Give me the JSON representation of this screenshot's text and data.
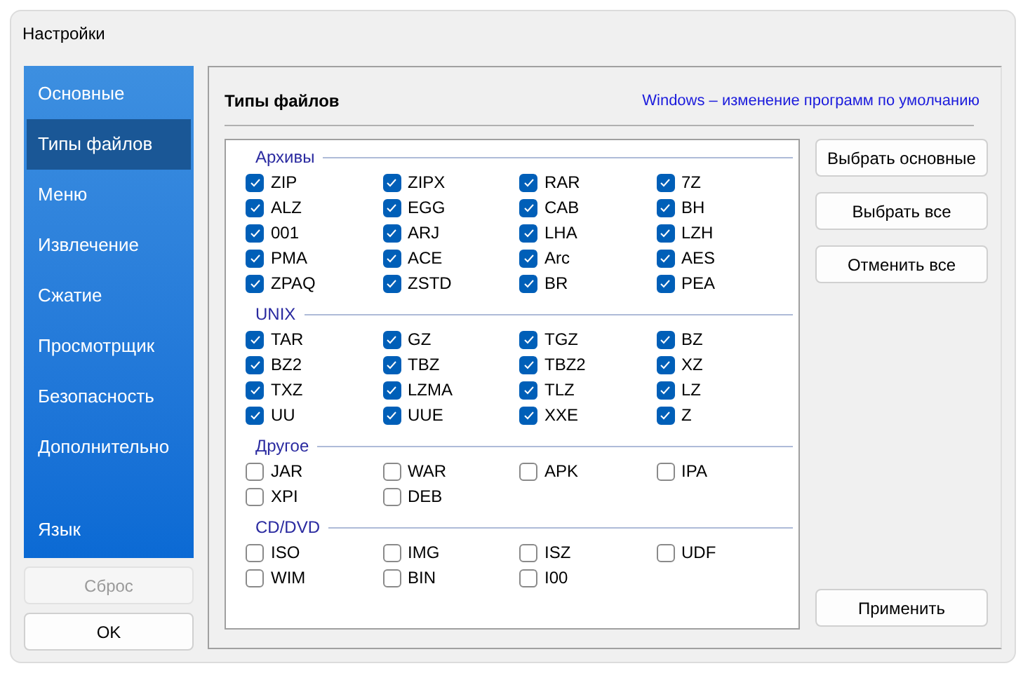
{
  "window": {
    "title": "Настройки"
  },
  "sidebar": {
    "items": [
      {
        "label": "Основные",
        "selected": false
      },
      {
        "label": "Типы файлов",
        "selected": true
      },
      {
        "label": "Меню",
        "selected": false
      },
      {
        "label": "Извлечение",
        "selected": false
      },
      {
        "label": "Сжатие",
        "selected": false
      },
      {
        "label": "Просмотрщик",
        "selected": false
      },
      {
        "label": "Безопасность",
        "selected": false
      },
      {
        "label": "Дополнительно",
        "selected": false
      }
    ],
    "bottom_items": [
      {
        "label": "Язык",
        "selected": false
      }
    ]
  },
  "reset_button": {
    "label": "Сброс",
    "disabled": true
  },
  "ok_button": {
    "label": "OK",
    "disabled": false
  },
  "panel": {
    "title": "Типы файлов",
    "link": "Windows – изменение программ по умолчанию"
  },
  "groups": [
    {
      "title": "Архивы",
      "items": [
        {
          "label": "ZIP",
          "checked": true
        },
        {
          "label": "ZIPX",
          "checked": true
        },
        {
          "label": "RAR",
          "checked": true
        },
        {
          "label": "7Z",
          "checked": true
        },
        {
          "label": "ALZ",
          "checked": true
        },
        {
          "label": "EGG",
          "checked": true
        },
        {
          "label": "CAB",
          "checked": true
        },
        {
          "label": "BH",
          "checked": true
        },
        {
          "label": "001",
          "checked": true
        },
        {
          "label": "ARJ",
          "checked": true
        },
        {
          "label": "LHA",
          "checked": true
        },
        {
          "label": "LZH",
          "checked": true
        },
        {
          "label": "PMA",
          "checked": true
        },
        {
          "label": "ACE",
          "checked": true
        },
        {
          "label": "Arc",
          "checked": true
        },
        {
          "label": "AES",
          "checked": true
        },
        {
          "label": "ZPAQ",
          "checked": true
        },
        {
          "label": "ZSTD",
          "checked": true
        },
        {
          "label": "BR",
          "checked": true
        },
        {
          "label": "PEA",
          "checked": true
        }
      ]
    },
    {
      "title": "UNIX",
      "items": [
        {
          "label": "TAR",
          "checked": true
        },
        {
          "label": "GZ",
          "checked": true
        },
        {
          "label": "TGZ",
          "checked": true
        },
        {
          "label": "BZ",
          "checked": true
        },
        {
          "label": "BZ2",
          "checked": true
        },
        {
          "label": "TBZ",
          "checked": true
        },
        {
          "label": "TBZ2",
          "checked": true
        },
        {
          "label": "XZ",
          "checked": true
        },
        {
          "label": "TXZ",
          "checked": true
        },
        {
          "label": "LZMA",
          "checked": true
        },
        {
          "label": "TLZ",
          "checked": true
        },
        {
          "label": "LZ",
          "checked": true
        },
        {
          "label": "UU",
          "checked": true
        },
        {
          "label": "UUE",
          "checked": true
        },
        {
          "label": "XXE",
          "checked": true
        },
        {
          "label": "Z",
          "checked": true
        }
      ]
    },
    {
      "title": "Другое",
      "items": [
        {
          "label": "JAR",
          "checked": false
        },
        {
          "label": "WAR",
          "checked": false
        },
        {
          "label": "APK",
          "checked": false
        },
        {
          "label": "IPA",
          "checked": false
        },
        {
          "label": "XPI",
          "checked": false
        },
        {
          "label": "DEB",
          "checked": false
        }
      ]
    },
    {
      "title": "CD/DVD",
      "items": [
        {
          "label": "ISO",
          "checked": false
        },
        {
          "label": "IMG",
          "checked": false
        },
        {
          "label": "ISZ",
          "checked": false
        },
        {
          "label": "UDF",
          "checked": false
        },
        {
          "label": "WIM",
          "checked": false
        },
        {
          "label": "BIN",
          "checked": false
        },
        {
          "label": "I00",
          "checked": false
        }
      ]
    }
  ],
  "side_buttons": [
    "Выбрать основные",
    "Выбрать все",
    "Отменить все"
  ],
  "apply_button": "Применить"
}
